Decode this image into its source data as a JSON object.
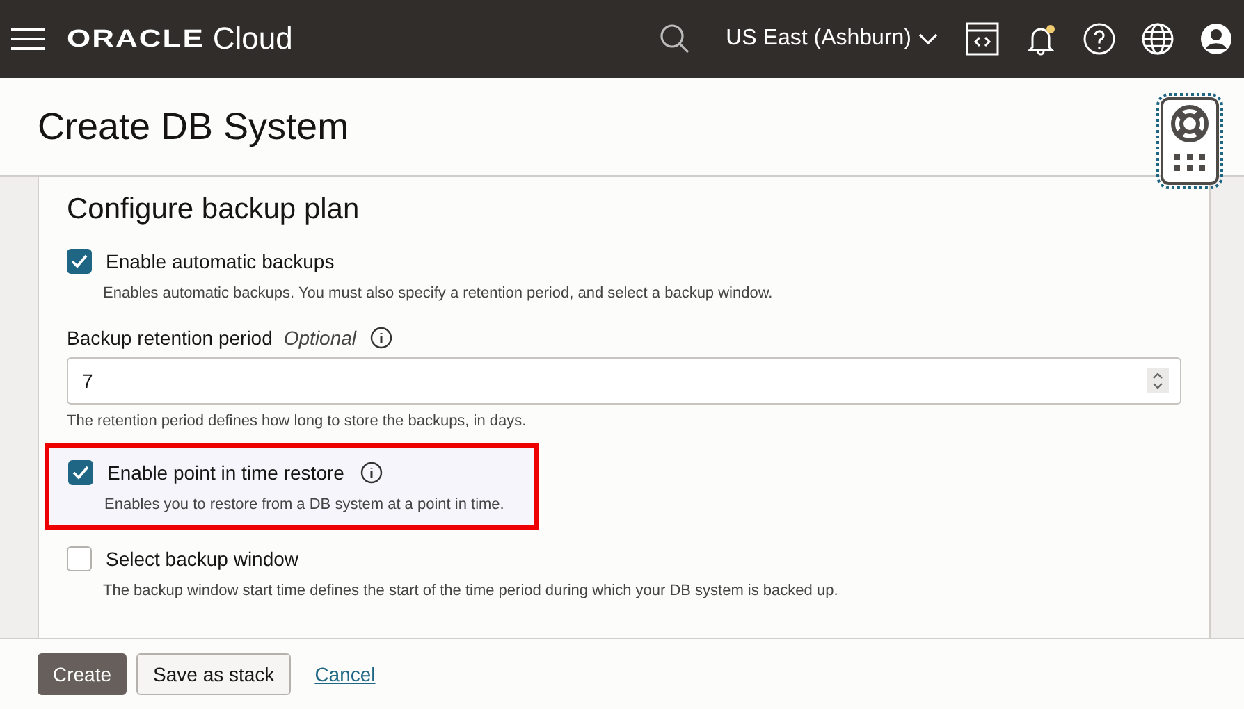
{
  "header": {
    "brand": "ORACLE",
    "product": "Cloud",
    "region": "US East (Ashburn)",
    "notification_unread": true
  },
  "page_title": "Create DB System",
  "section": {
    "title": "Configure backup plan",
    "items": [
      {
        "kind": "checkbox",
        "label": "Enable automatic backups",
        "checked": true,
        "highlighted": false,
        "info": false,
        "description": "Enables automatic backups. You must also specify a retention period, and select a backup window."
      },
      {
        "kind": "field",
        "label": "Backup retention period",
        "optional": "Optional",
        "info": true,
        "value": "7",
        "description": "The retention period defines how long to store the backups, in days."
      },
      {
        "kind": "checkbox",
        "label": "Enable point in time restore",
        "checked": true,
        "highlighted": true,
        "info": true,
        "description": "Enables you to restore from a DB system at a point in time."
      },
      {
        "kind": "checkbox",
        "label": "Select backup window",
        "checked": false,
        "highlighted": false,
        "info": false,
        "description": "The backup window start time defines the start of the time period during which your DB system is backed up."
      }
    ]
  },
  "footer": {
    "buttons": [
      {
        "kind": "primary",
        "label": "Create"
      },
      {
        "kind": "secondary",
        "label": "Save as stack"
      },
      {
        "kind": "link",
        "label": "Cancel"
      }
    ]
  }
}
